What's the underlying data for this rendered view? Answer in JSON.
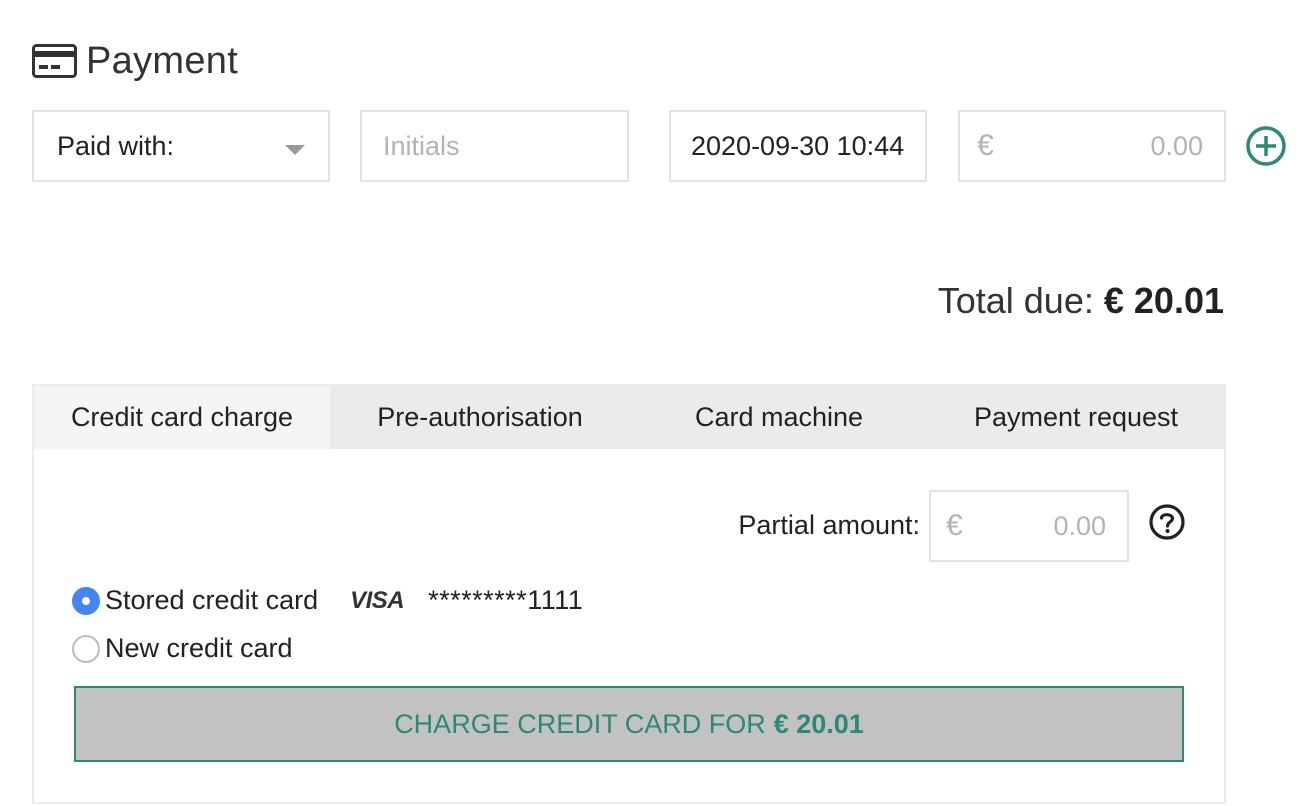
{
  "header": {
    "title": "Payment",
    "icon": "credit-card-icon"
  },
  "form": {
    "paid_with": "Paid with:",
    "initials_placeholder": "Initials",
    "datetime": "2020-09-30 10:44",
    "currency_symbol": "€",
    "amount_placeholder": "0.00"
  },
  "total": {
    "label": "Total due:",
    "value": "€ 20.01"
  },
  "tabs": [
    {
      "label": "Credit card charge",
      "active": true
    },
    {
      "label": "Pre-authorisation",
      "active": false
    },
    {
      "label": "Card machine",
      "active": false
    },
    {
      "label": "Payment request",
      "active": false
    }
  ],
  "charge": {
    "partial_label": "Partial amount:",
    "partial_currency": "€",
    "partial_placeholder": "0.00",
    "options": [
      {
        "label": "Stored credit card",
        "checked": true
      },
      {
        "label": "New credit card",
        "checked": false
      }
    ],
    "card_brand": "VISA",
    "card_number": "*********1111",
    "button_label": "CHARGE CREDIT CARD FOR",
    "button_amount": "€ 20.01"
  },
  "colors": {
    "accent": "#2a8a76",
    "radio": "#4285f4",
    "button_bg": "#c2c2c2",
    "tab_bg": "#ebebeb"
  }
}
